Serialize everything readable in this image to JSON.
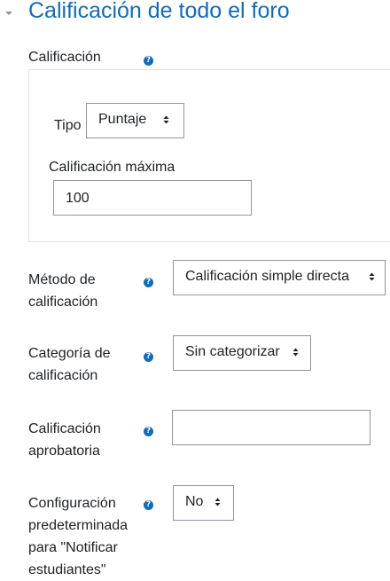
{
  "section": {
    "title": "Calificación de todo el foro",
    "collapse_icon": "chevron-down-icon"
  },
  "grade": {
    "label": "Calificación",
    "type_label": "Tipo",
    "type_value": "Puntaje",
    "max_label": "Calificación máxima",
    "max_value": "100"
  },
  "method": {
    "label_line1": "Método de",
    "label_line2": "calificación",
    "value": "Calificación simple directa"
  },
  "category": {
    "label_line1": "Categoría de",
    "label_line2": "calificación",
    "value": "Sin categorizar"
  },
  "pass": {
    "label_line1": "Calificación",
    "label_line2": "aprobatoria",
    "value": ""
  },
  "notify": {
    "label_line1": "Configuración",
    "label_line2": "predeterminada",
    "label_line3": "para \"Notificar",
    "label_line4": "estudiantes\"",
    "value": "No"
  },
  "colors": {
    "accent": "#0f6cbf",
    "text": "#1d2125",
    "border": "#8f959e"
  }
}
